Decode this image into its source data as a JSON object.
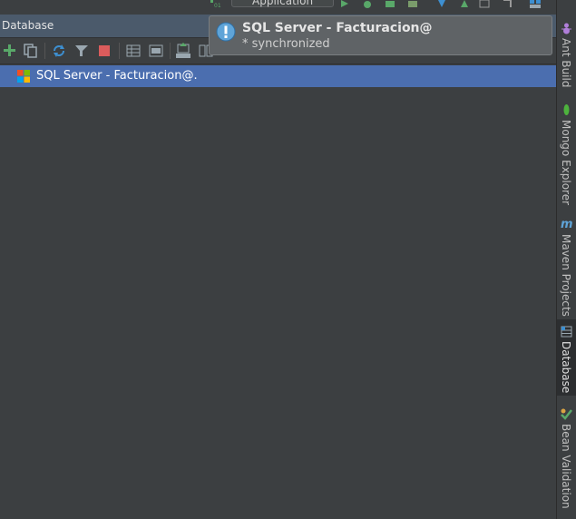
{
  "top_toolbar": {
    "run_configuration": "Application"
  },
  "database_panel": {
    "header_title": "Database",
    "toolbar_icons": [
      "add-icon",
      "copy-icon",
      "refresh-icon",
      "filter-icon",
      "stop-icon",
      "table-editor-icon",
      "sql-console-icon",
      "ddl-icon",
      "compare-icon"
    ],
    "tree": [
      {
        "label": "SQL Server - Facturacion@.",
        "icon": "mssql-icon",
        "selected": true
      }
    ]
  },
  "notification": {
    "title": "SQL Server - Facturacion@",
    "message": "* synchronized",
    "icon": "info-icon"
  },
  "right_stripe": [
    {
      "label": "Ant Build",
      "icon": "ant-icon",
      "active": false
    },
    {
      "label": "Mongo Explorer",
      "icon": "mongo-leaf-icon",
      "active": false
    },
    {
      "label": "Maven Projects",
      "icon": "maven-icon",
      "active": false
    },
    {
      "label": "Database",
      "icon": "database-icon",
      "active": true
    },
    {
      "label": "Bean Validation",
      "icon": "bean-validation-icon",
      "active": false
    }
  ],
  "colors": {
    "background": "#3c3f41",
    "header": "#4b5a6b",
    "selection": "#4b6eaf",
    "balloon": "#5f6366",
    "accent_green": "#59a869"
  }
}
